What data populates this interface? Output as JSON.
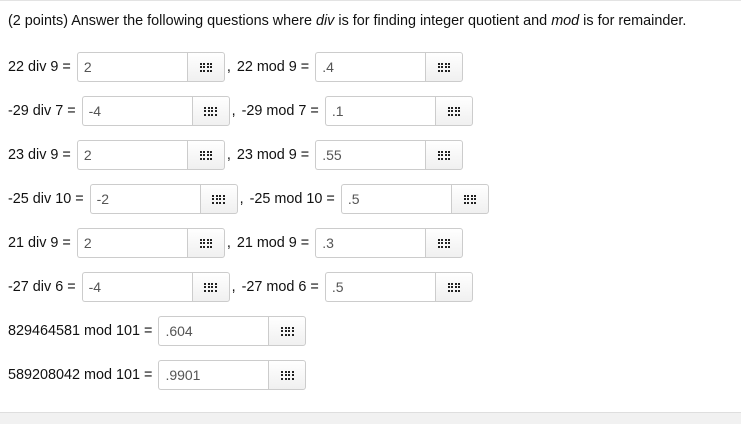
{
  "question": {
    "prefix": "(2 points) Answer the following questions where ",
    "div_word": "div",
    "middle": " is for finding integer quotient and ",
    "mod_word": "mod",
    "suffix": " is for remainder."
  },
  "separator": ",",
  "rows": [
    {
      "div_label": "22 div 9 =",
      "div_value": "2",
      "mod_label": "22 mod 9 =",
      "mod_value": ".4"
    },
    {
      "div_label": "-29 div 7 =",
      "div_value": "-4",
      "mod_label": "-29 mod 7 =",
      "mod_value": ".1"
    },
    {
      "div_label": "23 div 9 =",
      "div_value": "2",
      "mod_label": "23 mod 9 =",
      "mod_value": ".55"
    },
    {
      "div_label": "-25 div 10 =",
      "div_value": "-2",
      "mod_label": "-25 mod 10 =",
      "mod_value": ".5"
    },
    {
      "div_label": "21 div 9 =",
      "div_value": "2",
      "mod_label": "21 mod 9 =",
      "mod_value": ".3"
    },
    {
      "div_label": "-27 div 6 =",
      "div_value": "-4",
      "mod_label": "-27 mod 6 =",
      "mod_value": ".5"
    }
  ],
  "single_rows": [
    {
      "label": "829464581 mod 101 =",
      "value": ".604"
    },
    {
      "label": "589208042 mod 101 =",
      "value": ".9901"
    }
  ],
  "icons": {
    "palette": "grid-icon"
  }
}
